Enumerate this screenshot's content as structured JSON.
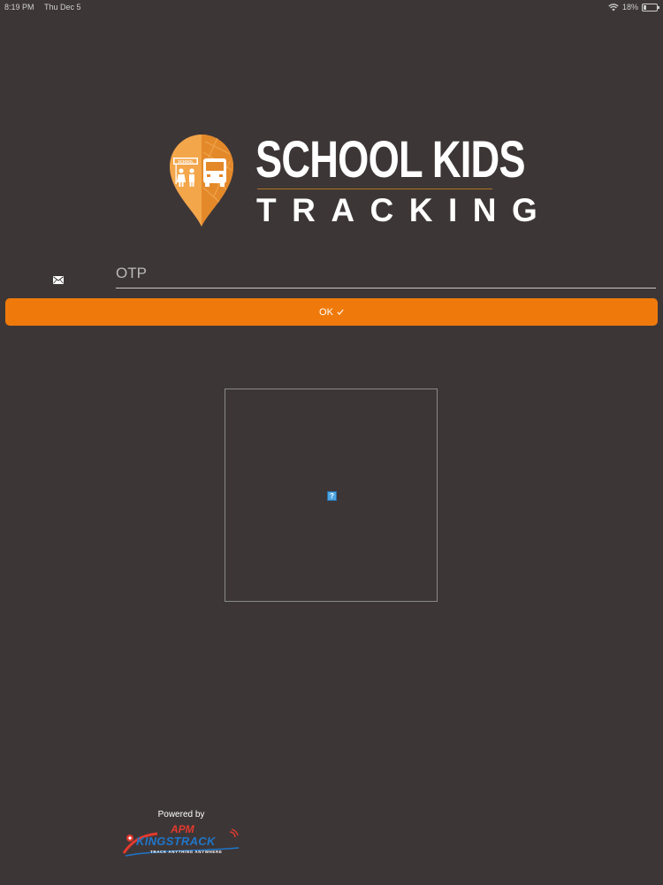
{
  "status_bar": {
    "time": "8:19 PM",
    "date": "Thu Dec 5",
    "battery": "18%",
    "battery_level": 0.18,
    "icons": [
      "wifi-icon",
      "battery-icon"
    ]
  },
  "logo": {
    "title": "SCHOOL KIDS",
    "subtitle": "TRACKING",
    "sign_text": "SCHOOL",
    "colors": {
      "pin": "#f3a64a",
      "pin_dark": "#e4892a",
      "rule": "#b0721f"
    }
  },
  "otp_field": {
    "placeholder": "OTP",
    "value": "",
    "icon": "mail-icon"
  },
  "ok_button": {
    "label": "OK",
    "icon": "checkmark-icon",
    "color": "#ef7a0b"
  },
  "image_placeholder": {
    "icon": "broken-image-icon",
    "glyph": "?"
  },
  "footer": {
    "powered_by": "Powered by",
    "brand_prefix": "APM",
    "brand_name": "KINGSTRACK",
    "tagline": "TRACK ANYTHING ANYWHERE"
  },
  "theme": {
    "background": "#3d3637",
    "text": "#ffffff"
  }
}
